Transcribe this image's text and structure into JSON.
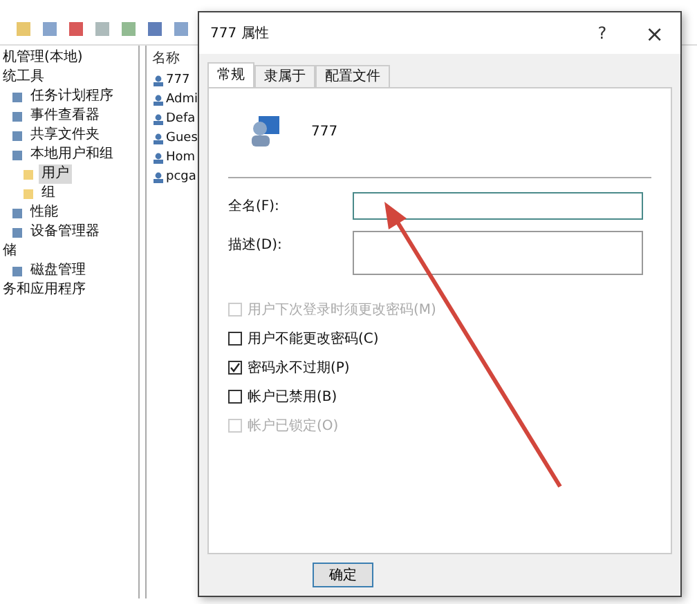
{
  "tree": [
    {
      "label": "机管理(本地)",
      "selected": false,
      "children": [
        {
          "label": "统工具",
          "selected": false,
          "children": [
            {
              "label": "任务计划程序",
              "selected": false
            },
            {
              "label": "事件查看器",
              "selected": false
            },
            {
              "label": "共享文件夹",
              "selected": false
            },
            {
              "label": "本地用户和组",
              "selected": false,
              "children": [
                {
                  "label": "用户",
                  "selected": true
                },
                {
                  "label": "组",
                  "selected": false
                }
              ]
            },
            {
              "label": "性能",
              "selected": false
            },
            {
              "label": "设备管理器",
              "selected": false
            }
          ]
        },
        {
          "label": "储",
          "selected": false,
          "children": [
            {
              "label": "磁盘管理",
              "selected": false
            }
          ]
        },
        {
          "label": "务和应用程序",
          "selected": false
        }
      ]
    }
  ],
  "list": {
    "column": "名称",
    "rows": [
      "777",
      "Admi",
      "Defa",
      "Gues",
      "Hom",
      "pcga"
    ]
  },
  "dialog": {
    "title": "777 属性",
    "help": "?",
    "close": "×",
    "tabs": [
      {
        "label": "常规",
        "selected": true
      },
      {
        "label": "隶属于",
        "selected": false
      },
      {
        "label": "配置文件",
        "selected": false
      }
    ],
    "user": "777",
    "fields": [
      {
        "label": "全名(F):",
        "kind": "line",
        "focused": true
      },
      {
        "label": "描述(D):",
        "kind": "area",
        "focused": false
      }
    ],
    "checks": [
      {
        "label": "用户下次登录时须更改密码(M)",
        "checked": false,
        "disabled": true
      },
      {
        "label": "用户不能更改密码(C)",
        "checked": false,
        "disabled": false
      },
      {
        "label": "密码永不过期(P)",
        "checked": true,
        "disabled": false
      },
      {
        "label": "帐户已禁用(B)",
        "checked": false,
        "disabled": false
      },
      {
        "label": "帐户已锁定(O)",
        "checked": false,
        "disabled": true
      }
    ],
    "buttons": [
      "确定"
    ]
  }
}
